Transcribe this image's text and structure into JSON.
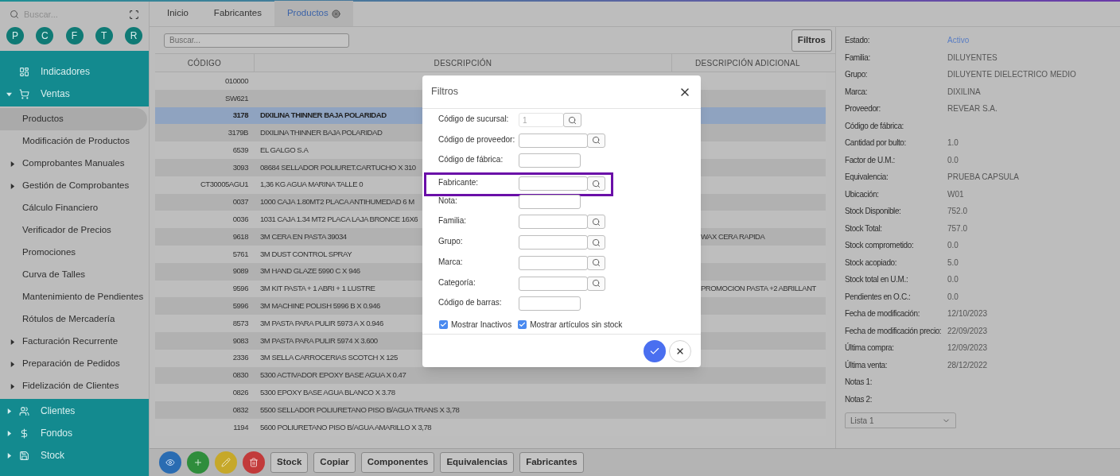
{
  "sidebar": {
    "search": {
      "placeholder": "Buscar..."
    },
    "shortcuts": [
      "P",
      "C",
      "F",
      "T",
      "R"
    ],
    "menu": [
      {
        "label": "Indicadores",
        "kind": "link"
      },
      {
        "label": "Ventas",
        "kind": "group",
        "expanded": true,
        "children": [
          {
            "label": "Productos",
            "kind": "link",
            "selected": true
          },
          {
            "label": "Modificación de Productos",
            "kind": "link",
            "selected": false
          },
          {
            "label": "Comprobantes Manuales",
            "kind": "group",
            "expanded": false,
            "selected": false
          },
          {
            "label": "Gestión de Comprobantes",
            "kind": "group",
            "expanded": false,
            "selected": false
          },
          {
            "label": "Cálculo Financiero",
            "kind": "link",
            "selected": false
          },
          {
            "label": "Verificador de Precios",
            "kind": "link",
            "selected": false
          },
          {
            "label": "Promociones",
            "kind": "link",
            "selected": false
          },
          {
            "label": "Curva de Talles",
            "kind": "link",
            "selected": false
          },
          {
            "label": "Mantenimiento de Pendientes",
            "kind": "link",
            "selected": false
          },
          {
            "label": "Rótulos de Mercadería",
            "kind": "link",
            "selected": false
          },
          {
            "label": "Facturación Recurrente",
            "kind": "group",
            "expanded": false,
            "selected": false
          },
          {
            "label": "Preparación de Pedidos",
            "kind": "group",
            "expanded": false,
            "selected": false
          },
          {
            "label": "Fidelización de Clientes",
            "kind": "group",
            "expanded": false,
            "selected": false
          }
        ]
      },
      {
        "label": "Clientes",
        "kind": "group",
        "expanded": false
      },
      {
        "label": "Fondos",
        "kind": "group",
        "expanded": false
      },
      {
        "label": "Stock",
        "kind": "group",
        "expanded": false
      }
    ]
  },
  "tabs": [
    {
      "label": "Inicio",
      "selected": false
    },
    {
      "label": "Fabricantes",
      "selected": false
    },
    {
      "label": "Productos",
      "selected": true
    }
  ],
  "search": {
    "placeholder": "Buscar..."
  },
  "filter_button": "Filtros",
  "table": {
    "columns": [
      "CÓDIGO",
      "DESCRIPCIÓN",
      "DESCRIPCIÓN ADICIONAL"
    ],
    "rows": [
      {
        "code": "010000",
        "selected": false
      },
      {
        "code": "SW621",
        "selected": false
      },
      {
        "code": "3178",
        "description": "DIXILINA THINNER BAJA POLARIDAD",
        "selected": true
      },
      {
        "code": "3179B",
        "description": "DIXILINA THINNER BAJA POLARIDAD",
        "selected": false
      },
      {
        "code": "6539",
        "description": "EL GALGO S.A",
        "selected": false
      },
      {
        "code": "3093",
        "description": "08684 SELLADOR POLIURET.CARTUCHO X 310",
        "selected": false
      },
      {
        "code": "CT30005AGU1",
        "description": "1,36 KG AGUA MARINA TALLE 0",
        "selected": false
      },
      {
        "code": "0037",
        "description": "1000 CAJA 1.80MT2 PLACA ANTIHUMEDAD 6 M",
        "selected": false
      },
      {
        "code": "0036",
        "description": "1031 CAJA 1.34 MT2 PLACA LAJA BRONCE 16X6",
        "selected": false
      },
      {
        "code": "9618",
        "description": "3M CERA EN PASTA 39034",
        "extra": "WAX CERA RAPIDA",
        "selected": false
      },
      {
        "code": "5761",
        "description": "3M DUST CONTROL SPRAY",
        "selected": false
      },
      {
        "code": "9089",
        "description": "3M HAND GLAZE 5990 C X 946",
        "selected": false
      },
      {
        "code": "9596",
        "description": "3M KIT PASTA + 1 ABRI + 1 LUSTRE",
        "extra": "PROMOCION PASTA +2 ABRILLANT",
        "selected": false
      },
      {
        "code": "5996",
        "description": "3M MACHINE POLISH 5996 B X 0.946",
        "selected": false
      },
      {
        "code": "8573",
        "description": "3M PASTA PARA PULIR 5973 A X 0.946",
        "selected": false
      },
      {
        "code": "9083",
        "description": "3M PASTA PARA PULIR 5974 X 3.600",
        "selected": false
      },
      {
        "code": "2336",
        "description": "3M SELLA CARROCERIAS SCOTCH X 125",
        "selected": false
      },
      {
        "code": "0830",
        "description": "5300 ACTIVADOR EPOXY BASE AGUA X 0.47",
        "selected": false
      },
      {
        "code": "0826",
        "description": "5300 EPOXY BASE AGUA BLANCO X 3.78",
        "selected": false
      },
      {
        "code": "0832",
        "description": "5500 SELLADOR POLIURETANO PISO B/AGUA TRANS X 3,78",
        "selected": false
      },
      {
        "code": "1194",
        "description": "5600 POLIURETANO PISO B/AGUA AMARILLO X 3,78",
        "selected": false
      }
    ]
  },
  "details": [
    {
      "label": "Estado:",
      "value": "Activo",
      "kind": "status"
    },
    {
      "label": "Familia:",
      "value": "DILUYENTES",
      "kind": "text"
    },
    {
      "label": "Grupo:",
      "value": "DILUYENTE DIELECTRICO MEDIO",
      "kind": "text"
    },
    {
      "label": "Marca:",
      "value": "DIXILINA",
      "kind": "text"
    },
    {
      "label": "Proveedor:",
      "value": "REVEAR S.A.",
      "kind": "text"
    },
    {
      "label": "Código de fábrica:",
      "kind": "text"
    },
    {
      "label": "Cantidad por bulto:",
      "value": "1.0",
      "kind": "text"
    },
    {
      "label": "Factor de U.M.:",
      "value": "0.0",
      "kind": "text"
    },
    {
      "label": "Equivalencia:",
      "value": "PRUEBA CAPSULA",
      "kind": "text"
    },
    {
      "label": "Ubicación:",
      "value": "W01",
      "kind": "text"
    },
    {
      "label": "Stock Disponible:",
      "value": "752.0",
      "kind": "text"
    },
    {
      "label": "Stock Total:",
      "value": "757.0",
      "kind": "text"
    },
    {
      "label": "Stock comprometido:",
      "value": "0.0",
      "kind": "text"
    },
    {
      "label": "Stock acopiado:",
      "value": "5.0",
      "kind": "text"
    },
    {
      "label": "Stock total en U.M.:",
      "value": "0.0",
      "kind": "text"
    },
    {
      "label": "Pendientes en O.C.:",
      "value": "0.0",
      "kind": "text"
    },
    {
      "label": "Fecha de modificación:",
      "value": "12/10/2023",
      "kind": "text"
    },
    {
      "label": "Fecha de modificación precio:",
      "value": "22/09/2023",
      "kind": "text"
    },
    {
      "label": "Última compra:",
      "value": "12/09/2023",
      "kind": "text"
    },
    {
      "label": "Última venta:",
      "value": "28/12/2022",
      "kind": "text"
    },
    {
      "label": "Notas 1:",
      "kind": "text"
    },
    {
      "label": "Notas 2:",
      "kind": "text"
    }
  ],
  "price_list": {
    "value": "Lista 1"
  },
  "toolbar": {
    "icon_buttons": [
      {
        "kind": "view"
      },
      {
        "kind": "add"
      },
      {
        "kind": "edit"
      },
      {
        "kind": "delete"
      }
    ],
    "buttons": [
      "Stock",
      "Copiar",
      "Componentes",
      "Equivalencias",
      "Fabricantes"
    ]
  },
  "dialog": {
    "title": "Filtros",
    "fields": [
      {
        "label": "Código de sucursal:",
        "kind": "lookup",
        "value": "1",
        "disabled": true,
        "highlighted": false
      },
      {
        "label": "Código de proveedor:",
        "kind": "lookup",
        "disabled": false,
        "highlighted": false
      },
      {
        "label": "Código de fábrica:",
        "kind": "text",
        "disabled": false,
        "highlighted": false
      },
      {
        "label": "Fabricante:",
        "kind": "lookup",
        "disabled": false,
        "highlighted": true
      },
      {
        "label": "Nota:",
        "kind": "text",
        "disabled": false,
        "highlighted": false
      },
      {
        "label": "Familia:",
        "kind": "lookup",
        "disabled": false,
        "highlighted": false
      },
      {
        "label": "Grupo:",
        "kind": "lookup",
        "disabled": false,
        "highlighted": false
      },
      {
        "label": "Marca:",
        "kind": "lookup",
        "disabled": false,
        "highlighted": false
      },
      {
        "label": "Categoría:",
        "kind": "lookup",
        "disabled": false,
        "highlighted": false
      },
      {
        "label": "Código de barras:",
        "kind": "text",
        "disabled": false,
        "highlighted": false
      }
    ],
    "checkboxes": [
      {
        "label": "Mostrar Inactivos",
        "checked": true
      },
      {
        "label": "Mostrar artículos sin stock",
        "checked": true
      }
    ]
  }
}
